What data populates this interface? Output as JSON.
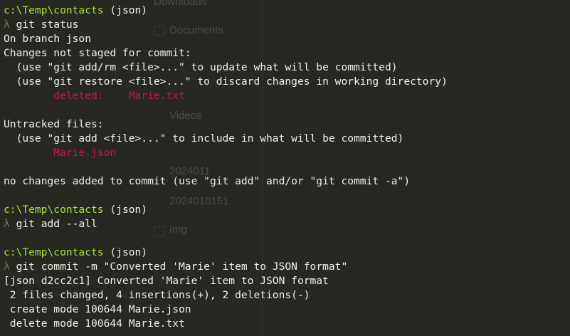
{
  "terminal": {
    "prompt_path": "c:\\Temp\\contacts",
    "branch_tag": " (json)",
    "lambda": "λ",
    "commands": {
      "status": " git status",
      "add": " git add --all",
      "commit": " git commit -m \"Converted 'Marie' item to JSON format\""
    },
    "status_output": {
      "on_branch": "On branch json",
      "not_staged_header": "Changes not staged for commit:",
      "hint_add_rm": "  (use \"git add/rm <file>...\" to update what will be committed)",
      "hint_restore": "  (use \"git restore <file>...\" to discard changes in working directory)",
      "deleted_indent": "        ",
      "deleted_label": "deleted:",
      "deleted_gap": "    ",
      "deleted_file": "Marie.txt",
      "untracked_header": "Untracked files:",
      "hint_untracked": "  (use \"git add <file>...\" to include in what will be committed)",
      "untracked_indent": "        ",
      "untracked_file": "Marie.json",
      "no_changes": "no changes added to commit (use \"git add\" and/or \"git commit -a\")"
    },
    "commit_output": {
      "summary": "[json d2cc2c1] Converted 'Marie' item to JSON format",
      "stats": " 2 files changed, 4 insertions(+), 2 deletions(-)",
      "create": " create mode 100644 Marie.json",
      "delete": " delete mode 100644 Marie.txt"
    }
  },
  "background_window": {
    "items": [
      "Downloads",
      "Documents",
      "Videos",
      "2024011",
      "2024010151",
      "Img"
    ]
  },
  "colors": {
    "background": "#272822",
    "prompt": "#a6e22e",
    "text": "#f0f0ea",
    "lambda": "#75715e",
    "git_red": "#c4164f"
  }
}
